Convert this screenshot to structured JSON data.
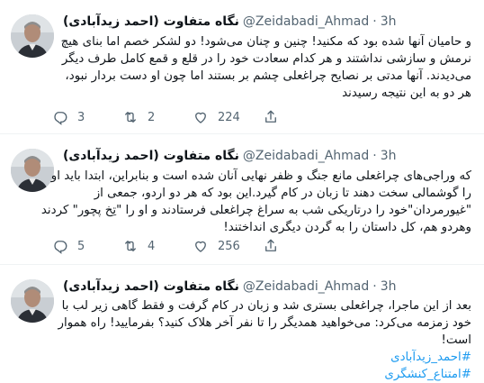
{
  "tweets": [
    {
      "display_name": "نگاه متفاوت (احمد زیدآبادی)",
      "handle": "@Zeidabadi_Ahmad",
      "separator": "·",
      "time": "3h",
      "lines": [
        "و حامیان آنها شده بود که مکنید! چنین و چنان می‌شود! دو لشکر خصم اما بنای هیچ",
        "نرمش و سازشی نداشتند و هر کدام سعادت خود را در قلع و قمع کامل طرف دیگر",
        "می‌دیدند. آنها مدتی بر نصایح چراغعلی چشم بر بستند اما چون او دست بردار نبود،",
        "هر دو به این نتیجه رسیدند"
      ],
      "hashtags": [],
      "reply_count": "3",
      "retweet_count": "2",
      "like_count": "224"
    },
    {
      "display_name": "نگاه متفاوت (احمد زیدآبادی)",
      "handle": "@Zeidabadi_Ahmad",
      "separator": "·",
      "time": "3h",
      "lines": [
        "که وراجی‌های چراغعلی مانع جنگ و ظفر نهایی آنان شده است و بنابراین، ابتدا باید او",
        "را گوشمالی سخت دهند تا زبان در کام گیرد.این بود که هر دو اردو، جمعی از",
        "\"غیورمردان\"خود را درتاریکی شب به سراغ چراغعلی فرستادند و او را \"تِخ پچور\" کردند",
        "وهردو هم، کل داستان را به گردن دیگری انداختند!"
      ],
      "hashtags": [],
      "reply_count": "5",
      "retweet_count": "4",
      "like_count": "256"
    },
    {
      "display_name": "نگاه متفاوت (احمد زیدآبادی)",
      "handle": "@Zeidabadi_Ahmad",
      "separator": "·",
      "time": "3h",
      "lines": [
        "بعد از این ماجرا، چراغعلی بستری شد و زبان در کام گرفت و فقط گاهی زیر لب با",
        "خود زمزمه می‌کرد: می‌خواهید همدیگر را تا نفر آخر هلاک کنید؟ بفرمایید! راه هموار",
        "است!"
      ],
      "hashtags": [
        "#احمد_زیدآبادی",
        "#امتناع_کنشگری"
      ],
      "reply_count": "",
      "retweet_count": "",
      "like_count": ""
    }
  ],
  "colors": {
    "text": "#0f1419",
    "muted": "#536471",
    "link": "#1d9bf0",
    "divider": "#eff3f4"
  },
  "icons": {
    "reply": "reply-icon",
    "retweet": "retweet-icon",
    "like": "like-icon",
    "share": "share-icon"
  }
}
